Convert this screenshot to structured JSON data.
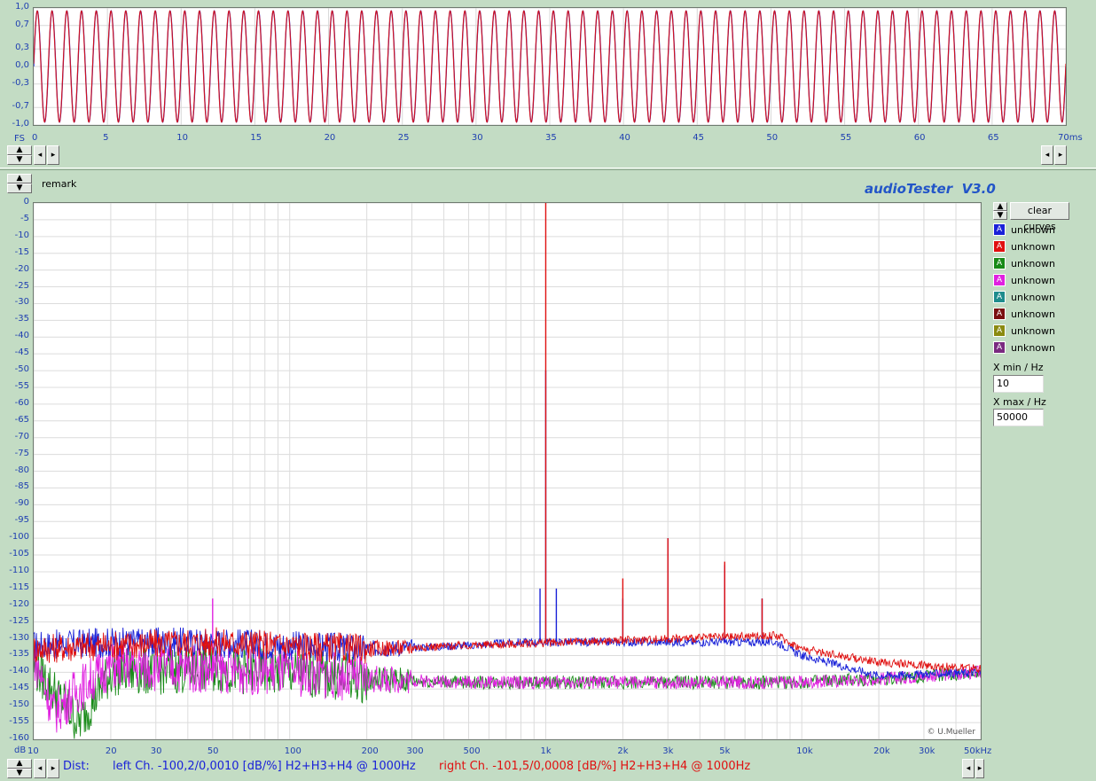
{
  "colors": {
    "background": "#c3dcc4",
    "axis_text": "#1f3fb1",
    "left_channel": "#1a22d8",
    "right_channel": "#e01010",
    "curve3": "#178a17",
    "curve4": "#e020e0"
  },
  "waveform": {
    "y_unit_label": "FS",
    "y_ticks": [
      "1,0",
      "0,7",
      "0,3",
      "0,0",
      "-0,3",
      "-0,7",
      "-1,0"
    ],
    "x_ticks": [
      "0",
      "5",
      "10",
      "15",
      "20",
      "25",
      "30",
      "35",
      "40",
      "45",
      "50",
      "55",
      "60",
      "65",
      "70ms"
    ]
  },
  "spectrum": {
    "remark_label": "remark",
    "app_title": "audioTester  V3.0",
    "y_unit_label": "dB",
    "y_ticks": [
      "0",
      "-5",
      "-10",
      "-15",
      "-20",
      "-25",
      "-30",
      "-35",
      "-40",
      "-45",
      "-50",
      "-55",
      "-60",
      "-65",
      "-70",
      "-75",
      "-80",
      "-85",
      "-90",
      "-95",
      "-100",
      "-105",
      "-110",
      "-115",
      "-120",
      "-125",
      "-130",
      "-135",
      "-140",
      "-145",
      "-150",
      "-155",
      "-160"
    ],
    "x_ticks": [
      "10",
      "20",
      "30",
      "50",
      "100",
      "200",
      "300",
      "500",
      "1k",
      "2k",
      "3k",
      "5k",
      "10k",
      "20k",
      "30k",
      "50kHz"
    ],
    "watermark": "© U.Mueller"
  },
  "controls": {
    "clear_curves_label": "clear curves",
    "legend": [
      {
        "glyph": "A",
        "label": "unknown",
        "color": "#1a22d8"
      },
      {
        "glyph": "A",
        "label": "unknown",
        "color": "#e01010"
      },
      {
        "glyph": "A",
        "label": "unknown",
        "color": "#178a17"
      },
      {
        "glyph": "A",
        "label": "unknown",
        "color": "#e020e0"
      },
      {
        "glyph": "A",
        "label": "unknown",
        "color": "#1e8c8c"
      },
      {
        "glyph": "A",
        "label": "unknown",
        "color": "#7a1010"
      },
      {
        "glyph": "A",
        "label": "unknown",
        "color": "#8a8a10"
      },
      {
        "glyph": "A",
        "label": "unknown",
        "color": "#7a2a80"
      }
    ],
    "xmin_label": "X min / Hz",
    "xmin_value": "10",
    "xmax_label": "X max / Hz",
    "xmax_value": "50000"
  },
  "status_bar": {
    "dist_label": "Dist:",
    "left_text": "left Ch. -100,2/0,0010 [dB/%] H2+H3+H4 @ 1000Hz",
    "right_text": "right Ch. -101,5/0,0008 [dB/%] H2+H3+H4 @ 1000Hz"
  },
  "chart_data": [
    {
      "type": "line",
      "title": "",
      "xlabel": "ms",
      "ylabel": "FS",
      "xlim": [
        0,
        70
      ],
      "ylim": [
        -1,
        1
      ],
      "series": [
        {
          "name": "",
          "description_values": {
            "frequency_hz": 1000,
            "amplitude_fs": 0.95
          }
        },
        {
          "name": "",
          "description_values": {
            "frequency_hz": 1000,
            "amplitude_fs": 0.95
          }
        }
      ]
    },
    {
      "type": "line",
      "title": "",
      "xlabel": "Hz",
      "ylabel": "dB",
      "xscale": "log",
      "xlim": [
        10,
        50000
      ],
      "ylim": [
        -160,
        0
      ],
      "grid": true,
      "series": [
        {
          "name": "left Ch.",
          "points": [
            [
              10,
              -132
            ],
            [
              20,
              -131
            ],
            [
              50,
              -131
            ],
            [
              100,
              -132
            ],
            [
              200,
              -133
            ],
            [
              500,
              -132
            ],
            [
              800,
              -131
            ],
            [
              950,
              -115
            ],
            [
              1000,
              -50
            ],
            [
              1100,
              -115
            ],
            [
              2000,
              -118
            ],
            [
              3000,
              -100
            ],
            [
              5000,
              -108
            ],
            [
              7000,
              -118
            ],
            [
              8000,
              -131
            ],
            [
              10000,
              -135
            ],
            [
              20000,
              -141
            ],
            [
              50000,
              -140
            ]
          ]
        },
        {
          "name": "right Ch.",
          "points": [
            [
              10,
              -133
            ],
            [
              20,
              -132
            ],
            [
              50,
              -131
            ],
            [
              100,
              -132
            ],
            [
              200,
              -133
            ],
            [
              500,
              -132
            ],
            [
              1000,
              0
            ],
            [
              2000,
              -112
            ],
            [
              3000,
              -100
            ],
            [
              5000,
              -107
            ],
            [
              7000,
              -118
            ],
            [
              8000,
              -129
            ],
            [
              10000,
              -133
            ],
            [
              20000,
              -137
            ],
            [
              50000,
              -139
            ]
          ]
        },
        {
          "name": "",
          "points": [
            [
              10,
              -138
            ],
            [
              15,
              -155
            ],
            [
              20,
              -140
            ],
            [
              50,
              -139
            ],
            [
              100,
              -140
            ],
            [
              200,
              -142
            ],
            [
              500,
              -143
            ],
            [
              1000,
              -143
            ],
            [
              2000,
              -143
            ],
            [
              5000,
              -143
            ],
            [
              10000,
              -143
            ],
            [
              20000,
              -142
            ],
            [
              50000,
              -140
            ]
          ]
        },
        {
          "name": "",
          "points": [
            [
              10,
              -135
            ],
            [
              12,
              -152
            ],
            [
              15,
              -145
            ],
            [
              20,
              -138
            ],
            [
              50,
              -118
            ],
            [
              100,
              -140
            ],
            [
              200,
              -142
            ],
            [
              500,
              -143
            ],
            [
              1000,
              -143
            ],
            [
              2000,
              -143
            ],
            [
              5000,
              -143
            ],
            [
              10000,
              -143
            ],
            [
              20000,
              -142
            ],
            [
              50000,
              -140
            ]
          ]
        }
      ]
    }
  ]
}
